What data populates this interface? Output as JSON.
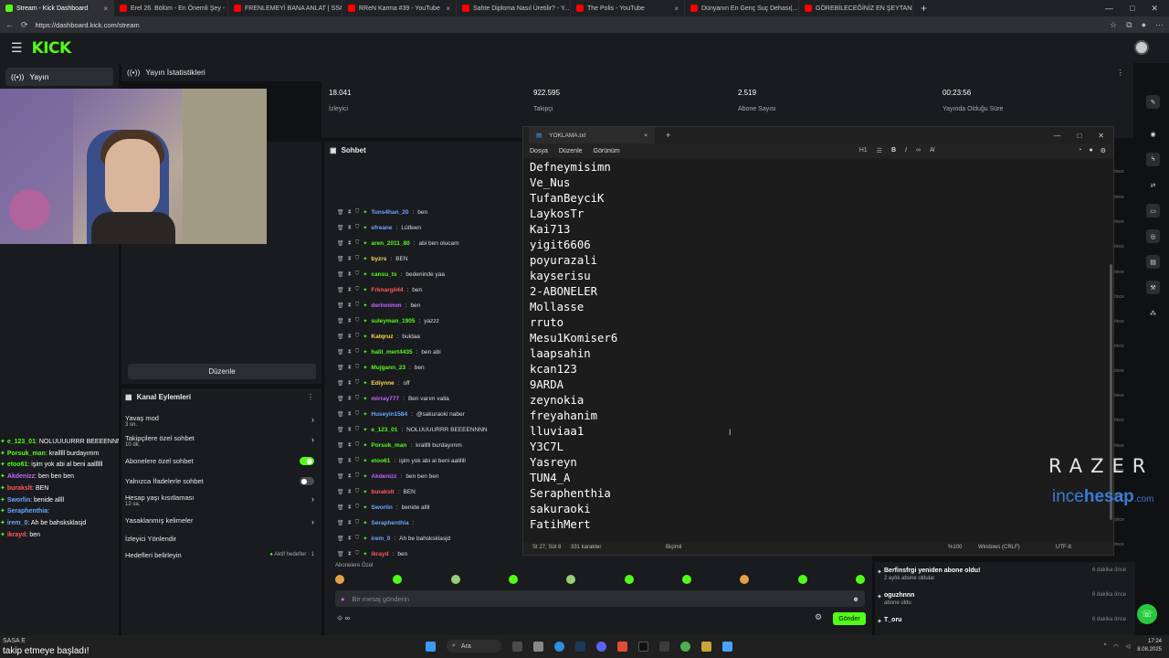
{
  "browser": {
    "tabs": [
      {
        "title": "Stream - Kick Dashboard",
        "color": "#53fc18",
        "active": true
      },
      {
        "title": "Erel 26. Bölüm - En Önemli Şey -",
        "color": "#ff0000"
      },
      {
        "title": "FRENLEMEYİ BANA ANLAT | SS#...",
        "color": "#ff0000"
      },
      {
        "title": "RReN Karma #39 - YouTube",
        "color": "#ff0000"
      },
      {
        "title": "Sahte Diploma Nasıl Üretilir? - Y...",
        "color": "#ff0000"
      },
      {
        "title": "The Polis - YouTube",
        "color": "#ff0000"
      },
      {
        "title": "Dünyanın En Genç Suç Dehası(...",
        "color": "#ff0000"
      },
      {
        "title": "GÖREBİLECEĞİNİZ EN ŞEYTANİ K...",
        "color": "#ff0000"
      }
    ],
    "url": "https://dashboard.kick.com/stream"
  },
  "kick": {
    "logo": "KICK",
    "nav_item": "Yayın"
  },
  "stats": {
    "title": "Yayın İstatistikleri",
    "items": [
      {
        "value": "18.041",
        "label": "İzleyici"
      },
      {
        "value": "922.595",
        "label": "Takipçi"
      },
      {
        "value": "2.519",
        "label": "Abone Sayısı"
      },
      {
        "value": "00:23:56",
        "label": "Yayında Olduğu Süre"
      }
    ]
  },
  "layout_panel": {
    "edit_label": "Düzenle"
  },
  "channel_actions": {
    "title": "Kanal Eylemleri",
    "rows": [
      {
        "label": "Yavaş mod",
        "sub": "3 sn.",
        "control": "chevron"
      },
      {
        "label": "Takipçilere özel sohbet",
        "sub": "10 dk.",
        "control": "chevron"
      },
      {
        "label": "Abonelere özel sohbet",
        "sub": "",
        "control": "toggle-on"
      },
      {
        "label": "Yalnızca İfadelerle sohbet",
        "sub": "",
        "control": "toggle-off"
      },
      {
        "label": "Hesap yaşı kısıtlaması",
        "sub": "12 sa.",
        "control": "chevron"
      },
      {
        "label": "Yasaklanmış kelimeler",
        "sub": "",
        "control": "chevron"
      },
      {
        "label": "İzleyici Yönlendir",
        "sub": "",
        "control": "none"
      },
      {
        "label": "Hedefleri belirleyin",
        "sub": "",
        "control": "goals"
      }
    ],
    "goals_status": "Aktif hedefler · 1"
  },
  "chat": {
    "title": "Sohbet",
    "messages": [
      {
        "user": "Tuns4han_20",
        "color": "#6aa7ff",
        "text": "ben"
      },
      {
        "user": "efreane",
        "color": "#6aa7ff",
        "text": "Lütfeen"
      },
      {
        "user": "aren_2011_80",
        "color": "#53fc18",
        "text": "abi ben olucam"
      },
      {
        "user": "byzrs",
        "color": "#ffd84a",
        "text": "BEN"
      },
      {
        "user": "cansu_ts",
        "color": "#53fc18",
        "text": "bedeninde yaa"
      },
      {
        "user": "Frknargil44",
        "color": "#ff5a5a",
        "text": "ben"
      },
      {
        "user": "derinnimm",
        "color": "#c065ff",
        "text": "ben"
      },
      {
        "user": "suleyman_1905",
        "color": "#53fc18",
        "text": "yazzz"
      },
      {
        "user": "Katqruz",
        "color": "#ffd84a",
        "text": "buldaa"
      },
      {
        "user": "halil_mert4435",
        "color": "#53fc18",
        "text": "ben abi"
      },
      {
        "user": "Mujgann_23",
        "color": "#53fc18",
        "text": "ben"
      },
      {
        "user": "Ediynne",
        "color": "#ffd84a",
        "text": "off"
      },
      {
        "user": "mirray777",
        "color": "#c065ff",
        "text": "Ben varım valla"
      },
      {
        "user": "Huseyin1584",
        "color": "#6aa7ff",
        "text": "@sakuraoki naber"
      },
      {
        "user": "e_123_01",
        "color": "#53fc18",
        "text": "NOLUUUURRR BEEEENNNN"
      },
      {
        "user": "Porsuk_man",
        "color": "#53fc18",
        "text": "kralllll burdayımm"
      },
      {
        "user": "etoo61",
        "color": "#53fc18",
        "text": "işim yok abi al beni aallllll"
      },
      {
        "user": "Akdenizz",
        "color": "#c065ff",
        "text": "ben ben ben"
      },
      {
        "user": "burakslt",
        "color": "#ff5a5a",
        "text": "BEN"
      },
      {
        "user": "Sworlin",
        "color": "#6aa7ff",
        "text": "benide allll"
      },
      {
        "user": "Seraphenthia",
        "color": "#6aa7ff",
        "text": ""
      },
      {
        "user": "irem_0",
        "color": "#6aa7ff",
        "text": "Ah be bahsksklasjd"
      },
      {
        "user": "ikrayd",
        "color": "#ff5a5a",
        "text": "ben"
      }
    ],
    "subs_only_label": "Abonelere Özel",
    "input_placeholder": "Bir mesaj gönderin",
    "send_label": "Gönder"
  },
  "left_chat": [
    {
      "user": "e_123_01",
      "color": "#53fc18",
      "text": "NOLUUUURRR BEEEENNNN"
    },
    {
      "user": "Porsuk_man",
      "color": "#53fc18",
      "text": "kralllll burdayımm"
    },
    {
      "user": "etoo61",
      "color": "#53fc18",
      "text": "işim yok abi al beni aallllll"
    },
    {
      "user": "Akdenizz",
      "color": "#c065ff",
      "text": "ben ben ben"
    },
    {
      "user": "burakslt",
      "color": "#ff5a5a",
      "text": "BEN"
    },
    {
      "user": "Sworlin",
      "color": "#6aa7ff",
      "text": "benide allll"
    },
    {
      "user": "Seraphenthia",
      "color": "#6aa7ff",
      "text": ""
    },
    {
      "user": "irem_0",
      "color": "#6aa7ff",
      "text": "Ah be bahsksklasjd"
    },
    {
      "user": "ikrayd",
      "color": "#ff5a5a",
      "text": "ben"
    }
  ],
  "left_bottom": {
    "name": "SASA E",
    "text": "takip etmeye başladı!"
  },
  "notepad": {
    "tab_title": "YOKLAMA.txt",
    "menu": [
      "Dosya",
      "Düzenle",
      "Görünüm"
    ],
    "heading_tool": "H1",
    "lines": [
      "Defneymisimn",
      "Ve_Nus",
      "TufanBeyciK",
      "LaykosTr",
      "Kai713",
      "yigit6606",
      "poyurazali",
      "kayserisu",
      "2-ABONELER",
      "Mollasse",
      "rruto",
      "Mesu1Komiser6",
      "laapsahin",
      "kcan123",
      "9ARDA",
      "zeynokia",
      "freyahanim",
      "lluviaa1",
      "Y3C7L",
      "Yasreyn",
      "TUN4_A",
      "Seraphenthia",
      "sakuraoki",
      "FatihMert"
    ],
    "status": {
      "position": "St 27, Süt 8",
      "chars": "331 karakter",
      "format": "Biçimli",
      "zoom": "%100",
      "eol": "Windows (CRLF)",
      "encoding": "UTF-8"
    }
  },
  "activity": [
    {
      "name": "Berfinsfrgi yeniden abone oldu!",
      "sub": "2 aylık abone oldular",
      "time": "6 dakika önce"
    },
    {
      "name": "oguzhnnn",
      "sub": "abone oldu",
      "time": "6 dakika önce"
    },
    {
      "name": "T_oru",
      "sub": "",
      "time": "6 dakika önce"
    }
  ],
  "right_col_label": "önce",
  "watermark": {
    "brand": "RAZER",
    "site_a": "ince",
    "site_b": "hesap",
    "site_c": ".com"
  },
  "taskbar": {
    "search": "Ara",
    "time": "17:24",
    "date": "8.08.2025"
  }
}
